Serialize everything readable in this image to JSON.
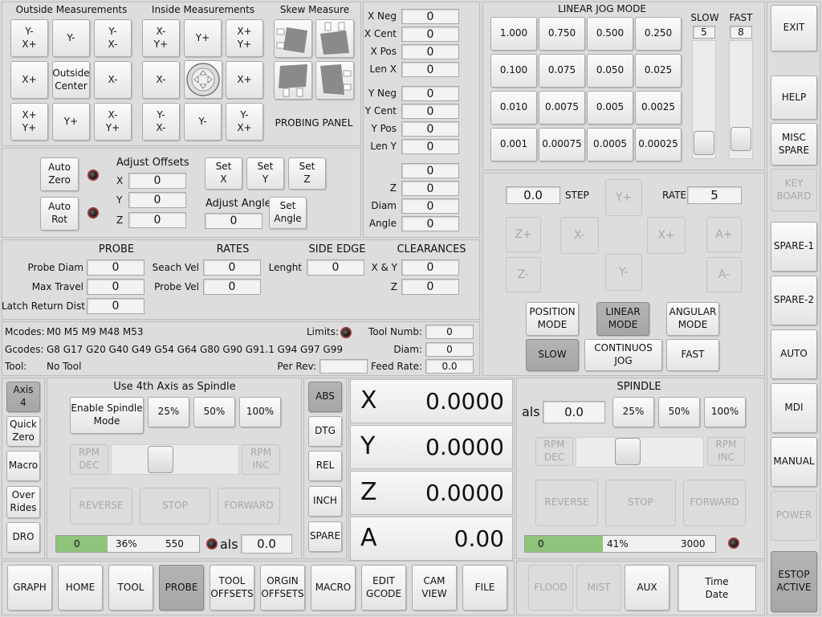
{
  "probing": {
    "outside_title": "Outside Measurements",
    "inside_title": "Inside Measurements",
    "skew_title": "Skew Measure",
    "panel_label": "PROBING  PANEL",
    "outside_buttons": [
      "Y-\nX+",
      "Y-",
      "Y-\nX-",
      "X+",
      "Outside\nCenter",
      "X-",
      "X+\nY+",
      "Y+",
      "X-\nY+"
    ],
    "inside_buttons": [
      "X-\nY+",
      "Y+",
      "X+\nY+",
      "X-",
      "",
      "X+",
      "Y-\nX-",
      "Y-",
      "Y-\nX+"
    ],
    "skew_icons": [
      "skew-top-left-icon",
      "skew-top-right-icon",
      "skew-bottom-left-icon",
      "skew-bottom-right-icon"
    ],
    "center_icon": "inside-center-icon"
  },
  "results": {
    "labels": [
      "X Neg",
      "X Cent",
      "X Pos",
      "Len X",
      "Y Neg",
      "Y Cent",
      "Y Pos",
      "Len Y",
      "",
      "Z",
      "Diam",
      "Angle"
    ],
    "values": [
      "0",
      "0",
      "0",
      "0",
      "0",
      "0",
      "0",
      "0",
      "0",
      "0",
      "0",
      "0"
    ]
  },
  "offsets": {
    "auto_zero": "Auto\nZero",
    "auto_rot": "Auto\nRot",
    "adjust_offsets_title": "Adjust Offsets",
    "x_label": "X",
    "y_label": "Y",
    "z_label": "Z",
    "x": "0",
    "y": "0",
    "z": "0",
    "set_x": "Set\nX",
    "set_y": "Set\nY",
    "set_z": "Set\nZ",
    "adjust_angle_title": "Adjust Angle",
    "angle": "0",
    "set_angle": "Set\nAngle"
  },
  "probe_params": {
    "probe_title": "PROBE",
    "rates_title": "RATES",
    "side_edge_title": "SIDE EDGE",
    "clearances_title": "CLEARANCES",
    "probe_diam_label": "Probe Diam",
    "probe_diam": "0",
    "max_travel_label": "Max Travel",
    "max_travel": "0",
    "latch_label": "Latch Return Dist",
    "latch": "0",
    "search_vel_label": "Seach Vel",
    "search_vel": "0",
    "probe_vel_label": "Probe Vel",
    "probe_vel": "0",
    "length_label": "Lenght",
    "length": "0",
    "xy_label": "X & Y",
    "xy": "0",
    "z_label": "Z",
    "z": "0"
  },
  "status": {
    "mcodes_label": "Mcodes:",
    "mcodes": "M0 M5 M9 M48 M53",
    "gcodes_label": "Gcodes:",
    "gcodes": "G8 G17 G20 G40 G49 G54 G64 G80 G90 G91.1 G94 G97 G99",
    "tool_label": "Tool:",
    "tool": "No Tool",
    "limits_label": "Limits:",
    "tool_numb_label": "Tool Numb:",
    "tool_numb": "0",
    "diam_label": "Diam:",
    "diam": "0",
    "per_rev_label": "Per Rev:",
    "per_rev": "",
    "feed_rate_label": "Feed Rate:",
    "feed_rate": "0.0"
  },
  "jog": {
    "title": "LINEAR  JOG  MODE",
    "increments": [
      "1.000",
      "0.750",
      "0.500",
      "0.250",
      "0.100",
      "0.075",
      "0.050",
      "0.025",
      "0.010",
      "0.0075",
      "0.005",
      "0.0025",
      "0.001",
      "0.00075",
      "0.0005",
      "0.00025"
    ],
    "slow_label": "SLOW",
    "slow_value": "5",
    "fast_label": "FAST",
    "fast_value": "8",
    "step_value": "0.0",
    "step_label": "STEP",
    "rate_label": "RATE",
    "rate_value": "5",
    "axis_buttons": {
      "y_plus": "Y+",
      "z_plus": "Z+",
      "x_minus": "X-",
      "x_plus": "X+",
      "a_plus": "A+",
      "z_minus": "Z-",
      "y_minus": "Y-",
      "a_minus": "A-"
    },
    "position_mode": "POSITION\nMODE",
    "linear_mode": "LINEAR\nMODE",
    "angular_mode": "ANGULAR\nMODE",
    "slow": "SLOW",
    "continuous": "CONTINUOS\nJOG",
    "fast": "FAST"
  },
  "right_menu": {
    "exit": "EXIT",
    "help": "HELP",
    "misc_spare": "MISC\nSPARE",
    "keyboard": "KEY\nBOARD",
    "spare1": "SPARE-1",
    "spare2": "SPARE-2",
    "auto": "AUTO",
    "mdi": "MDI",
    "manual": "MANUAL",
    "power": "POWER",
    "estop": "ESTOP\nACTIVE"
  },
  "left_tabs": {
    "axis4": "Axis\n4",
    "quick_zero": "Quick\nZero",
    "macro": "Macro",
    "overrides": "Over\nRides",
    "dro": "DRO"
  },
  "spindle4": {
    "title": "Use 4th Axis as Spindle",
    "enable": "Enable Spindle\nMode",
    "p25": "25%",
    "p50": "50%",
    "p100": "100%",
    "rpm_dec": "RPM\nDEC",
    "rpm_inc": "RPM\nINC",
    "reverse": "REVERSE",
    "stop": "STOP",
    "forward": "FORWARD",
    "bar_value": "0",
    "bar_percent": "36%",
    "bar_max": "550",
    "bar_fraction": 0.36,
    "als_label": "als",
    "als_value": "0.0"
  },
  "dro": {
    "modes": [
      "ABS",
      "DTG",
      "REL",
      "INCH",
      "SPARE"
    ],
    "axes": [
      {
        "axis": "X",
        "value": "0.0000"
      },
      {
        "axis": "Y",
        "value": "0.0000"
      },
      {
        "axis": "Z",
        "value": "0.0000"
      },
      {
        "axis": "A",
        "value": "0.00"
      }
    ]
  },
  "spindle": {
    "title": "SPINDLE",
    "als_label": "als",
    "als_value": "0.0",
    "p25": "25%",
    "p50": "50%",
    "p100": "100%",
    "rpm_dec": "RPM\nDEC",
    "rpm_inc": "RPM\nINC",
    "reverse": "REVERSE",
    "stop": "STOP",
    "forward": "FORWARD",
    "bar_value": "0",
    "bar_percent": "41%",
    "bar_max": "3000",
    "bar_fraction": 0.41
  },
  "bottom_tabs": [
    "GRAPH",
    "HOME",
    "TOOL",
    "PROBE",
    "TOOL\nOFFSETS",
    "ORGIN\nOFFSETS",
    "MACRO",
    "EDIT\nGCODE",
    "CAM\nVIEW",
    "FILE"
  ],
  "coolant": {
    "flood": "FLOOD",
    "mist": "MIST",
    "aux": "AUX",
    "time_date": "Time\nDate"
  },
  "colors": {
    "led_ring": "#9a3a3a",
    "bar_fill": "#8fc47c",
    "active_button": "#aaaaaa"
  }
}
